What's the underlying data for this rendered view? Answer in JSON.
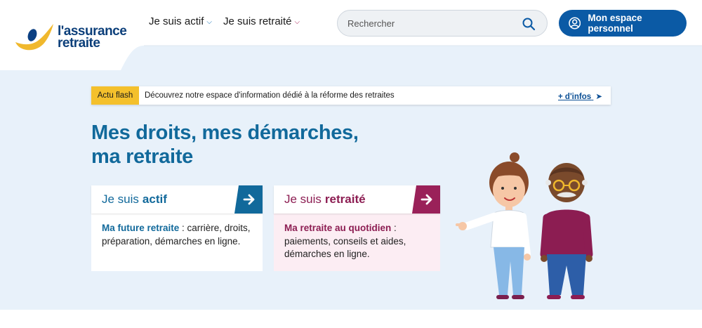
{
  "logo": {
    "line1": "l'assurance",
    "line2": "retraite"
  },
  "nav": {
    "items": [
      {
        "label": "Je suis actif"
      },
      {
        "label": "Je suis retraité"
      }
    ]
  },
  "search": {
    "placeholder": "Rechercher"
  },
  "account": {
    "label": "Mon espace personnel"
  },
  "flash": {
    "badge": "Actu flash",
    "text": "Découvrez notre espace d'information dédié à la réforme des retraites",
    "link": "+ d'infos"
  },
  "title": {
    "line1": "Mes droits, mes démarches,",
    "line2": "ma retraite"
  },
  "cards": {
    "actif": {
      "prefix": "Je suis",
      "strong": "actif",
      "lead": "Ma future retraite",
      "text": " : carrière, droits, préparation, démarches en ligne."
    },
    "retraite": {
      "prefix": "Je suis",
      "strong": "retraité",
      "lead": "Ma retraite au quotidien",
      "text": " : paiements, conseils et aides, démarches en ligne."
    }
  },
  "colors": {
    "brand_blue": "#0b5aa5",
    "title_blue": "#11699b",
    "retraite_plum": "#8c1d52",
    "flash_yellow": "#f4c02c",
    "hero_bg": "#e8f1fa"
  },
  "icons": [
    "logo-mark",
    "chevron-down-icon",
    "search-icon",
    "user-icon",
    "arrow-right-icon"
  ]
}
